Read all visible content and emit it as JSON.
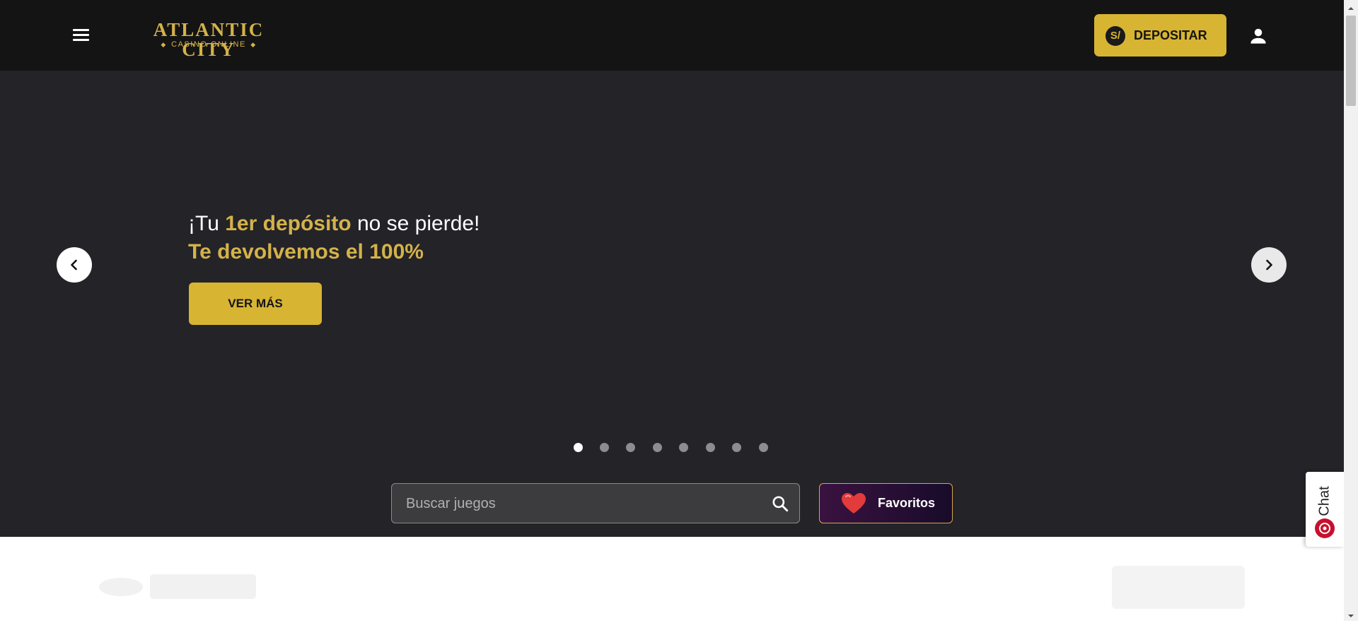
{
  "header": {
    "logo_main": "ATLANTIC CITY",
    "logo_sub": "CASINO ONLINE",
    "deposit_currency": "S/",
    "deposit_label": "DEPOSITAR"
  },
  "hero": {
    "line1_prefix": "¡Tu ",
    "line1_highlight": "1er depósito",
    "line1_suffix": " no se pierde!",
    "line2": "Te devolvemos el 100%",
    "cta_label": "VER MÁS",
    "slide_count": 8,
    "active_slide": 1
  },
  "search": {
    "placeholder": "Buscar juegos"
  },
  "favorites": {
    "label": "Favoritos"
  },
  "chat": {
    "label": "Chat"
  },
  "colors": {
    "header_bg": "#141414",
    "hero_bg": "#232328",
    "accent_gold": "#d8b433",
    "text_gold": "#d4b24a"
  },
  "icons": [
    "menu-icon",
    "coin-icon",
    "user-icon",
    "chevron-left-icon",
    "chevron-right-icon",
    "search-icon",
    "heart-icon",
    "chat-icon"
  ]
}
